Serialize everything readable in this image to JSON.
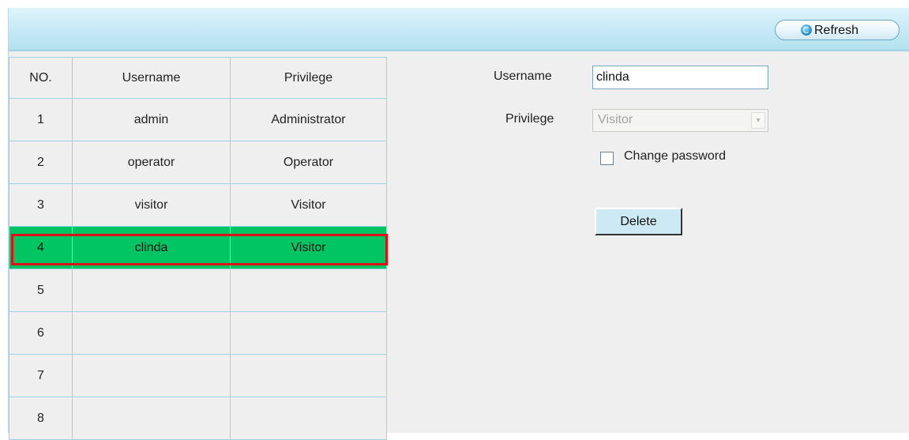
{
  "toolbar": {
    "refresh_label": "Refresh"
  },
  "table": {
    "headers": [
      "NO.",
      "Username",
      "Privilege"
    ],
    "rows": [
      {
        "no": "1",
        "username": "admin",
        "privilege": "Administrator"
      },
      {
        "no": "2",
        "username": "operator",
        "privilege": "Operator"
      },
      {
        "no": "3",
        "username": "visitor",
        "privilege": "Visitor"
      },
      {
        "no": "4",
        "username": "clinda",
        "privilege": "Visitor"
      },
      {
        "no": "5",
        "username": "",
        "privilege": ""
      },
      {
        "no": "6",
        "username": "",
        "privilege": ""
      },
      {
        "no": "7",
        "username": "",
        "privilege": ""
      },
      {
        "no": "8",
        "username": "",
        "privilege": ""
      }
    ],
    "selected_row_color": "#00c562",
    "selection_outline_color": "#e0101a"
  },
  "form": {
    "username_label": "Username",
    "username_value": "clinda",
    "privilege_label": "Privilege",
    "privilege_value": "Visitor",
    "privilege_disabled": true,
    "change_password_label": "Change password",
    "change_password_checked": false,
    "delete_label": "Delete"
  },
  "icons": {
    "refresh": "refresh-icon",
    "dropdown": "chevron-down-icon"
  }
}
